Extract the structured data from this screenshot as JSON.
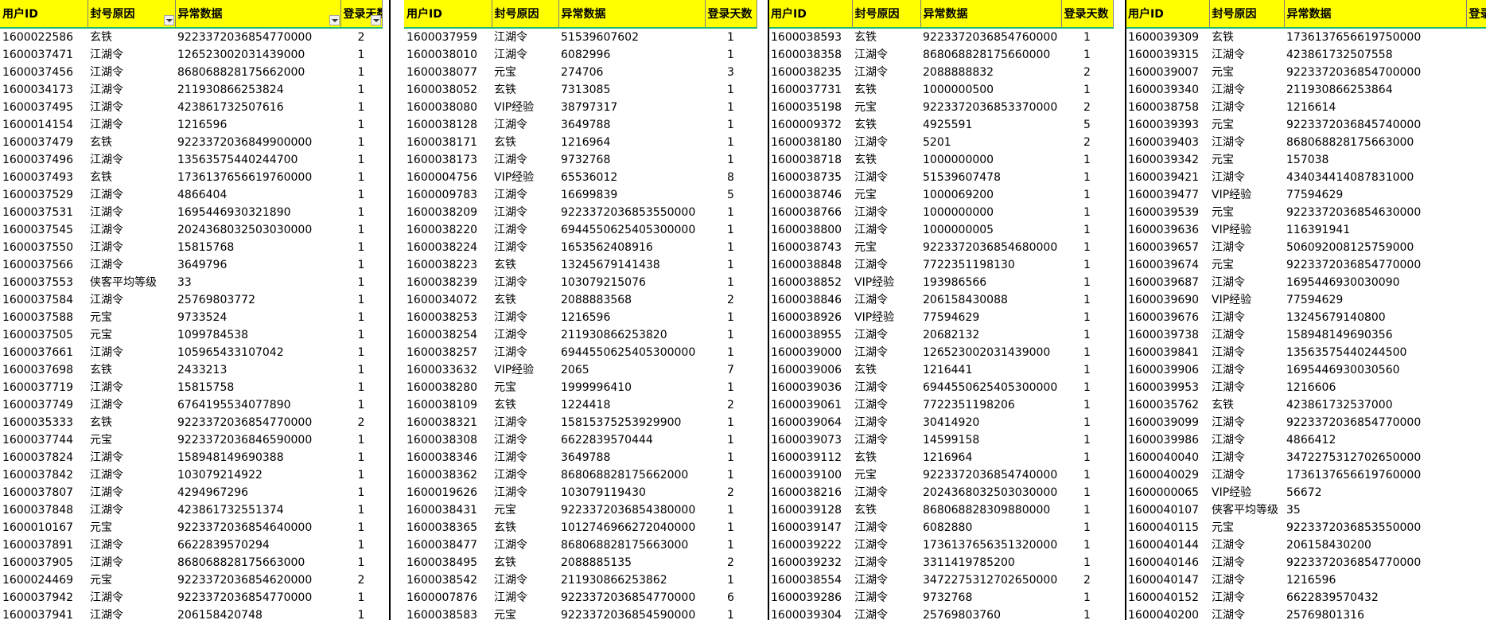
{
  "columns": [
    "用户ID",
    "封号原因",
    "异常数据",
    "登录天数"
  ],
  "panels": [
    {
      "rows": [
        [
          "1600022586",
          "玄铁",
          "9223372036854770000",
          "2"
        ],
        [
          "1600037471",
          "江湖令",
          "126523002031439000",
          "1"
        ],
        [
          "1600037456",
          "江湖令",
          "868068828175662000",
          "1"
        ],
        [
          "1600034173",
          "江湖令",
          "211930866253824",
          "1"
        ],
        [
          "1600037495",
          "江湖令",
          "423861732507616",
          "1"
        ],
        [
          "1600014154",
          "江湖令",
          "1216596",
          "1"
        ],
        [
          "1600037479",
          "玄铁",
          "9223372036849900000",
          "1"
        ],
        [
          "1600037496",
          "江湖令",
          "13563575440244700",
          "1"
        ],
        [
          "1600037493",
          "玄铁",
          "1736137656619760000",
          "1"
        ],
        [
          "1600037529",
          "江湖令",
          "4866404",
          "1"
        ],
        [
          "1600037531",
          "江湖令",
          "1695446930321890",
          "1"
        ],
        [
          "1600037545",
          "江湖令",
          "2024368032503030000",
          "1"
        ],
        [
          "1600037550",
          "江湖令",
          "15815768",
          "1"
        ],
        [
          "1600037566",
          "江湖令",
          "3649796",
          "1"
        ],
        [
          "1600037553",
          "侠客平均等级",
          "33",
          "1"
        ],
        [
          "1600037584",
          "江湖令",
          "25769803772",
          "1"
        ],
        [
          "1600037588",
          "元宝",
          "9733524",
          "1"
        ],
        [
          "1600037505",
          "元宝",
          "1099784538",
          "1"
        ],
        [
          "1600037661",
          "江湖令",
          "105965433107042",
          "1"
        ],
        [
          "1600037698",
          "玄铁",
          "2433213",
          "1"
        ],
        [
          "1600037719",
          "江湖令",
          "15815758",
          "1"
        ],
        [
          "1600037749",
          "江湖令",
          "6764195534077890",
          "1"
        ],
        [
          "1600035333",
          "玄铁",
          "9223372036854770000",
          "2"
        ],
        [
          "1600037744",
          "元宝",
          "9223372036846590000",
          "1"
        ],
        [
          "1600037824",
          "江湖令",
          "158948149690388",
          "1"
        ],
        [
          "1600037842",
          "江湖令",
          "103079214922",
          "1"
        ],
        [
          "1600037807",
          "江湖令",
          "4294967296",
          "1"
        ],
        [
          "1600037848",
          "江湖令",
          "423861732551374",
          "1"
        ],
        [
          "1600010167",
          "元宝",
          "9223372036854640000",
          "1"
        ],
        [
          "1600037891",
          "江湖令",
          "6622839570294",
          "1"
        ],
        [
          "1600037905",
          "江湖令",
          "868068828175663000",
          "1"
        ],
        [
          "1600024469",
          "元宝",
          "9223372036854620000",
          "2"
        ],
        [
          "1600037942",
          "江湖令",
          "9223372036854770000",
          "1"
        ],
        [
          "1600037941",
          "江湖令",
          "206158420748",
          "1"
        ]
      ]
    },
    {
      "rows": [
        [
          "1600037959",
          "江湖令",
          "51539607602",
          "1"
        ],
        [
          "1600038010",
          "江湖令",
          "6082996",
          "1"
        ],
        [
          "1600038077",
          "元宝",
          "274706",
          "3"
        ],
        [
          "1600038052",
          "玄铁",
          "7313085",
          "1"
        ],
        [
          "1600038080",
          "VIP经验",
          "38797317",
          "1"
        ],
        [
          "1600038128",
          "江湖令",
          "3649788",
          "1"
        ],
        [
          "1600038171",
          "玄铁",
          "1216964",
          "1"
        ],
        [
          "1600038173",
          "江湖令",
          "9732768",
          "1"
        ],
        [
          "1600004756",
          "VIP经验",
          "65536012",
          "8"
        ],
        [
          "1600009783",
          "江湖令",
          "16699839",
          "5"
        ],
        [
          "1600038209",
          "江湖令",
          "9223372036853550000",
          "1"
        ],
        [
          "1600038220",
          "江湖令",
          "6944550625405300000",
          "1"
        ],
        [
          "1600038224",
          "江湖令",
          "1653562408916",
          "1"
        ],
        [
          "1600038223",
          "玄铁",
          "13245679141438",
          "1"
        ],
        [
          "1600038239",
          "江湖令",
          "103079215076",
          "1"
        ],
        [
          "1600034072",
          "玄铁",
          "2088883568",
          "2"
        ],
        [
          "1600038253",
          "江湖令",
          "1216596",
          "1"
        ],
        [
          "1600038254",
          "江湖令",
          "211930866253820",
          "1"
        ],
        [
          "1600038257",
          "江湖令",
          "6944550625405300000",
          "1"
        ],
        [
          "1600033632",
          "VIP经验",
          "2065",
          "7"
        ],
        [
          "1600038280",
          "元宝",
          "1999996410",
          "1"
        ],
        [
          "1600038109",
          "玄铁",
          "1224418",
          "2"
        ],
        [
          "1600038321",
          "江湖令",
          "15815375253929900",
          "1"
        ],
        [
          "1600038308",
          "江湖令",
          "6622839570444",
          "1"
        ],
        [
          "1600038346",
          "江湖令",
          "3649788",
          "1"
        ],
        [
          "1600038362",
          "江湖令",
          "868068828175662000",
          "1"
        ],
        [
          "1600019626",
          "江湖令",
          "103079119430",
          "2"
        ],
        [
          "1600038431",
          "元宝",
          "9223372036854380000",
          "1"
        ],
        [
          "1600038365",
          "玄铁",
          "1012746966272040000",
          "1"
        ],
        [
          "1600038477",
          "江湖令",
          "868068828175663000",
          "1"
        ],
        [
          "1600038495",
          "玄铁",
          "2088885135",
          "2"
        ],
        [
          "1600038542",
          "江湖令",
          "211930866253862",
          "1"
        ],
        [
          "1600007876",
          "江湖令",
          "9223372036854770000",
          "6"
        ],
        [
          "1600038583",
          "元宝",
          "9223372036854590000",
          "1"
        ]
      ]
    },
    {
      "rows": [
        [
          "1600038593",
          "玄铁",
          "9223372036854760000",
          "1"
        ],
        [
          "1600038358",
          "江湖令",
          "868068828175660000",
          "1"
        ],
        [
          "1600038235",
          "江湖令",
          "2088888832",
          "2"
        ],
        [
          "1600037731",
          "玄铁",
          "1000000500",
          "1"
        ],
        [
          "1600035198",
          "元宝",
          "9223372036853370000",
          "2"
        ],
        [
          "1600009372",
          "玄铁",
          "4925591",
          "5"
        ],
        [
          "1600038180",
          "江湖令",
          "5201",
          "2"
        ],
        [
          "1600038718",
          "玄铁",
          "1000000000",
          "1"
        ],
        [
          "1600038735",
          "江湖令",
          "51539607478",
          "1"
        ],
        [
          "1600038746",
          "元宝",
          "1000069200",
          "1"
        ],
        [
          "1600038766",
          "江湖令",
          "1000000000",
          "1"
        ],
        [
          "1600038800",
          "江湖令",
          "1000000005",
          "1"
        ],
        [
          "1600038743",
          "元宝",
          "9223372036854680000",
          "1"
        ],
        [
          "1600038848",
          "江湖令",
          "7722351198130",
          "1"
        ],
        [
          "1600038852",
          "VIP经验",
          "193986566",
          "1"
        ],
        [
          "1600038846",
          "江湖令",
          "206158430088",
          "1"
        ],
        [
          "1600038926",
          "VIP经验",
          "77594629",
          "1"
        ],
        [
          "1600038955",
          "江湖令",
          "20682132",
          "1"
        ],
        [
          "1600039000",
          "江湖令",
          "126523002031439000",
          "1"
        ],
        [
          "1600039006",
          "玄铁",
          "1216441",
          "1"
        ],
        [
          "1600039036",
          "江湖令",
          "6944550625405300000",
          "1"
        ],
        [
          "1600039061",
          "江湖令",
          "7722351198206",
          "1"
        ],
        [
          "1600039064",
          "江湖令",
          "30414920",
          "1"
        ],
        [
          "1600039073",
          "江湖令",
          "14599158",
          "1"
        ],
        [
          "1600039112",
          "玄铁",
          "1216964",
          "1"
        ],
        [
          "1600039100",
          "元宝",
          "9223372036854740000",
          "1"
        ],
        [
          "1600038216",
          "江湖令",
          "2024368032503030000",
          "1"
        ],
        [
          "1600039128",
          "玄铁",
          "868068828309880000",
          "1"
        ],
        [
          "1600039147",
          "江湖令",
          "6082880",
          "1"
        ],
        [
          "1600039222",
          "江湖令",
          "1736137656351320000",
          "1"
        ],
        [
          "1600039232",
          "江湖令",
          "3311419785200",
          "1"
        ],
        [
          "1600038554",
          "江湖令",
          "3472275312702650000",
          "2"
        ],
        [
          "1600039286",
          "江湖令",
          "9732768",
          "1"
        ],
        [
          "1600039304",
          "江湖令",
          "25769803760",
          "1"
        ]
      ]
    },
    {
      "rows": [
        [
          "1600039309",
          "玄铁",
          "1736137656619750000",
          "1"
        ],
        [
          "1600039315",
          "江湖令",
          "423861732507558",
          "1"
        ],
        [
          "1600039007",
          "元宝",
          "9223372036854700000",
          "2"
        ],
        [
          "1600039340",
          "江湖令",
          "211930866253864",
          "1"
        ],
        [
          "1600038758",
          "江湖令",
          "1216614",
          "2"
        ],
        [
          "1600039393",
          "元宝",
          "9223372036845740000",
          "1"
        ],
        [
          "1600039403",
          "江湖令",
          "868068828175663000",
          "1"
        ],
        [
          "1600039342",
          "元宝",
          "157038",
          "1"
        ],
        [
          "1600039421",
          "江湖令",
          "434034414087831000",
          "1"
        ],
        [
          "1600039477",
          "VIP经验",
          "77594629",
          "1"
        ],
        [
          "1600039539",
          "元宝",
          "9223372036854630000",
          "1"
        ],
        [
          "1600039636",
          "VIP经验",
          "116391941",
          "1"
        ],
        [
          "1600039657",
          "江湖令",
          "506092008125759000",
          "1"
        ],
        [
          "1600039674",
          "元宝",
          "9223372036854770000",
          "1"
        ],
        [
          "1600039687",
          "江湖令",
          "1695446930030090",
          "1"
        ],
        [
          "1600039690",
          "VIP经验",
          "77594629",
          "1"
        ],
        [
          "1600039676",
          "江湖令",
          "13245679140800",
          "1"
        ],
        [
          "1600039738",
          "江湖令",
          "158948149690356",
          "1"
        ],
        [
          "1600039841",
          "江湖令",
          "13563575440244500",
          "1"
        ],
        [
          "1600039906",
          "江湖令",
          "1695446930030560",
          "1"
        ],
        [
          "1600039953",
          "江湖令",
          "1216606",
          "1"
        ],
        [
          "1600035762",
          "玄铁",
          "423861732537000",
          "2"
        ],
        [
          "1600039099",
          "江湖令",
          "9223372036854770000",
          "2"
        ],
        [
          "1600039986",
          "江湖令",
          "4866412",
          "1"
        ],
        [
          "1600040040",
          "江湖令",
          "3472275312702650000",
          "1"
        ],
        [
          "1600040029",
          "江湖令",
          "1736137656619760000",
          "1"
        ],
        [
          "1600000065",
          "VIP经验",
          "56672",
          "48"
        ],
        [
          "1600040107",
          "侠客平均等级",
          "35",
          "1"
        ],
        [
          "1600040115",
          "元宝",
          "9223372036853550000",
          "1"
        ],
        [
          "1600040144",
          "江湖令",
          "206158430200",
          "1"
        ],
        [
          "1600040146",
          "江湖令",
          "9223372036854770000",
          "1"
        ],
        [
          "1600040147",
          "江湖令",
          "1216596",
          "1"
        ],
        [
          "1600040152",
          "江湖令",
          "6622839570432",
          "1"
        ],
        [
          "1600040200",
          "江湖令",
          "25769801316",
          "1"
        ]
      ]
    }
  ]
}
